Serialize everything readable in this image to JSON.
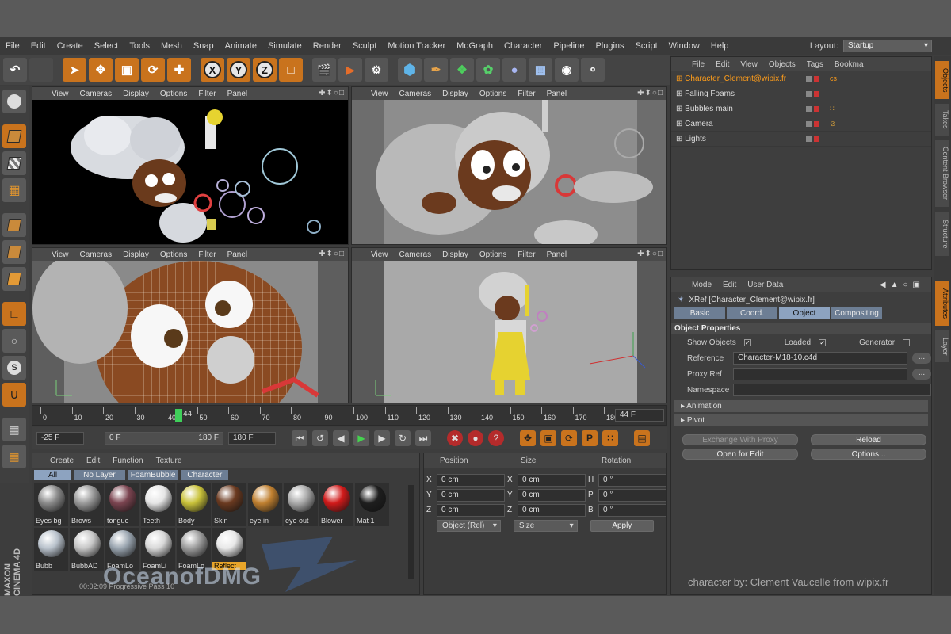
{
  "menu": [
    "File",
    "Edit",
    "Create",
    "Select",
    "Tools",
    "Mesh",
    "Snap",
    "Animate",
    "Simulate",
    "Render",
    "Sculpt",
    "Motion Tracker",
    "MoGraph",
    "Character",
    "Pipeline",
    "Plugins",
    "Script",
    "Window",
    "Help"
  ],
  "layout": {
    "label": "Layout:",
    "value": "Startup"
  },
  "toolbar": {
    "x": "X",
    "y": "Y",
    "z": "Z"
  },
  "viewport_menu": [
    "View",
    "Cameras",
    "Display",
    "Options",
    "Filter",
    "Panel"
  ],
  "viewport_icons": "✚⬍○□",
  "timeline": {
    "ticks": [
      "0",
      "10",
      "20",
      "30",
      "40",
      "50",
      "60",
      "70",
      "80",
      "90",
      "100",
      "110",
      "120",
      "130",
      "140",
      "150",
      "160",
      "170",
      "180"
    ],
    "current": "44",
    "end_field": "44 F"
  },
  "transport": {
    "start": "-25 F",
    "range_start": "0 F",
    "range_end": "180 F",
    "end": "180 F"
  },
  "material_manager": {
    "menu": [
      "Create",
      "Edit",
      "Function",
      "Texture"
    ],
    "filters": [
      "All",
      "No Layer",
      "FoamBubble",
      "Character"
    ],
    "materials": [
      {
        "label": "Eyes bg",
        "color": "#8a8a8a"
      },
      {
        "label": "Brows",
        "color": "#9a9a9a"
      },
      {
        "label": "tongue",
        "color": "#7b4450"
      },
      {
        "label": "Teeth",
        "color": "#e6e6e6"
      },
      {
        "label": "Body",
        "color": "#c9c23a"
      },
      {
        "label": "Skin",
        "color": "#6b3a20"
      },
      {
        "label": "eye in",
        "color": "#c08030"
      },
      {
        "label": "eye out",
        "color": "#aaaaaa"
      },
      {
        "label": "Blower",
        "color": "#d11a1a"
      },
      {
        "label": "Mat 1",
        "color": "#1e1e1e"
      },
      {
        "label": "Bubb",
        "color": "#b9c2cc"
      },
      {
        "label": "BubbAD",
        "color": "#c6c6c6"
      },
      {
        "label": "FoamLo",
        "color": "#9aa5b0"
      },
      {
        "label": "FoamLi",
        "color": "#d8d8d8"
      },
      {
        "label": "FoamLo",
        "color": "#9d9d9d"
      },
      {
        "label": "Reflect",
        "color": "#e8e8e8"
      }
    ],
    "highlighted_index": 15,
    "status": "00:02:09 Progressive Pass 10"
  },
  "coords": {
    "headers": [
      "Position",
      "Size",
      "Rotation"
    ],
    "rows": [
      {
        "p": "X",
        "pv": "0 cm",
        "s": "X",
        "sv": "0 cm",
        "r": "H",
        "rv": "0 °"
      },
      {
        "p": "Y",
        "pv": "0 cm",
        "s": "Y",
        "sv": "0 cm",
        "r": "P",
        "rv": "0 °"
      },
      {
        "p": "Z",
        "pv": "0 cm",
        "s": "Z",
        "sv": "0 cm",
        "r": "B",
        "rv": "0 °"
      }
    ],
    "mode": "Object (Rel)",
    "size_mode": "Size",
    "apply": "Apply"
  },
  "object_manager": {
    "menu": [
      "File",
      "Edit",
      "View",
      "Objects",
      "Tags",
      "Bookma"
    ],
    "objects": [
      {
        "name": "Character_Clement@wipix.fr",
        "selected": true,
        "tag": "cs"
      },
      {
        "name": "Falling Foams",
        "selected": false,
        "tag": ""
      },
      {
        "name": "Bubbles main",
        "selected": false,
        "tag": "∷"
      },
      {
        "name": "Camera",
        "selected": false,
        "tag": "⊘"
      },
      {
        "name": "Lights",
        "selected": false,
        "tag": ""
      }
    ]
  },
  "side_tabs": [
    "Objects",
    "Takes",
    "Content Browser",
    "Structure"
  ],
  "side_tabs_lower": [
    "Attributes",
    "Layer"
  ],
  "attribute_manager": {
    "menu": [
      "Mode",
      "Edit",
      "User Data"
    ],
    "title": "XRef [Character_Clement@wipix.fr]",
    "tabs": [
      "Basic",
      "Coord.",
      "Object",
      "Compositing"
    ],
    "active_tab": "Object",
    "section": "Object Properties",
    "show_objects": "Show Objects",
    "loaded": "Loaded",
    "generator": "Generator",
    "reference_label": "Reference",
    "reference_value": "Character-M18-10.c4d",
    "proxy_label": "Proxy Ref",
    "namespace_label": "Namespace",
    "folds": [
      "Animation",
      "Pivot"
    ],
    "buttons": [
      "Exchange With Proxy",
      "Reload",
      "Open for Edit",
      "Options..."
    ]
  },
  "credit": "character by: Clement Vaucelle from wipix.fr",
  "watermark": {
    "text": "OceanofDMG",
    "brand": "MAXON CINEMA 4D"
  },
  "colors": {
    "accent": "#c9731d",
    "selected": "#ff9d1a",
    "tab_active": "#8da3c0"
  }
}
